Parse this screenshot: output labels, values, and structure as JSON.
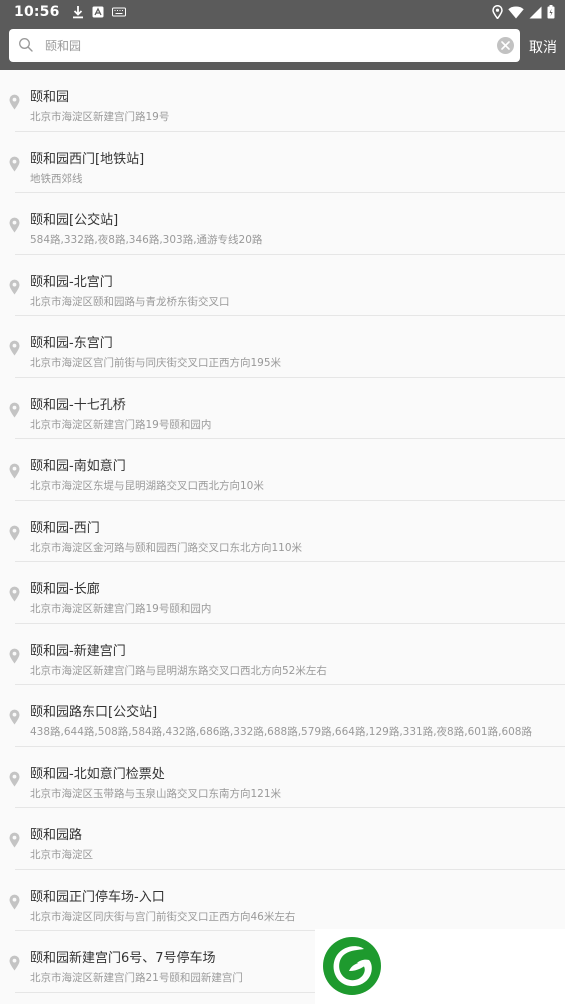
{
  "status_bar": {
    "time": "10:56",
    "left_icons": [
      "download-icon",
      "app-notification-icon",
      "keyboard-icon"
    ],
    "right_icons": [
      "location-icon",
      "wifi-icon",
      "signal-icon",
      "battery-icon"
    ]
  },
  "search": {
    "value": "",
    "placeholder": "颐和园",
    "cancel_label": "取消"
  },
  "results": [
    {
      "title": "颐和园",
      "subtitle": "北京市海淀区新建宫门路19号"
    },
    {
      "title": "颐和园西门[地铁站]",
      "subtitle": "地铁西郊线"
    },
    {
      "title": "颐和园[公交站]",
      "subtitle": "584路,332路,夜8路,346路,303路,通游专线20路"
    },
    {
      "title": "颐和园-北宫门",
      "subtitle": "北京市海淀区颐和园路与青龙桥东街交叉口"
    },
    {
      "title": "颐和园-东宫门",
      "subtitle": "北京市海淀区宫门前街与同庆街交叉口正西方向195米"
    },
    {
      "title": "颐和园-十七孔桥",
      "subtitle": "北京市海淀区新建宫门路19号颐和园内"
    },
    {
      "title": "颐和园-南如意门",
      "subtitle": "北京市海淀区东堤与昆明湖路交叉口西北方向10米"
    },
    {
      "title": "颐和园-西门",
      "subtitle": "北京市海淀区金河路与颐和园西门路交叉口东北方向110米"
    },
    {
      "title": "颐和园-长廊",
      "subtitle": "北京市海淀区新建宫门路19号颐和园内"
    },
    {
      "title": "颐和园-新建宫门",
      "subtitle": "北京市海淀区新建宫门路与昆明湖东路交叉口西北方向52米左右"
    },
    {
      "title": "颐和园路东口[公交站]",
      "subtitle": "438路,644路,508路,584路,432路,686路,332路,688路,579路,664路,129路,331路,夜8路,601路,608路"
    },
    {
      "title": "颐和园-北如意门检票处",
      "subtitle": "北京市海淀区玉带路与玉泉山路交叉口东南方向121米"
    },
    {
      "title": "颐和园路",
      "subtitle": "北京市海淀区"
    },
    {
      "title": "颐和园正门停车场-入口",
      "subtitle": "北京市海淀区同庆街与宫门前街交叉口正西方向46米左右"
    },
    {
      "title": "颐和园新建宫门6号、7号停车场",
      "subtitle": "北京市海淀区新建宫门路21号颐和园新建宫门"
    }
  ],
  "colors": {
    "header_bg": "#5b5b5b",
    "list_bg": "#fafafa",
    "title_text": "#333333",
    "subtitle_text": "#999999",
    "logo_green": "#1e9a2e"
  }
}
